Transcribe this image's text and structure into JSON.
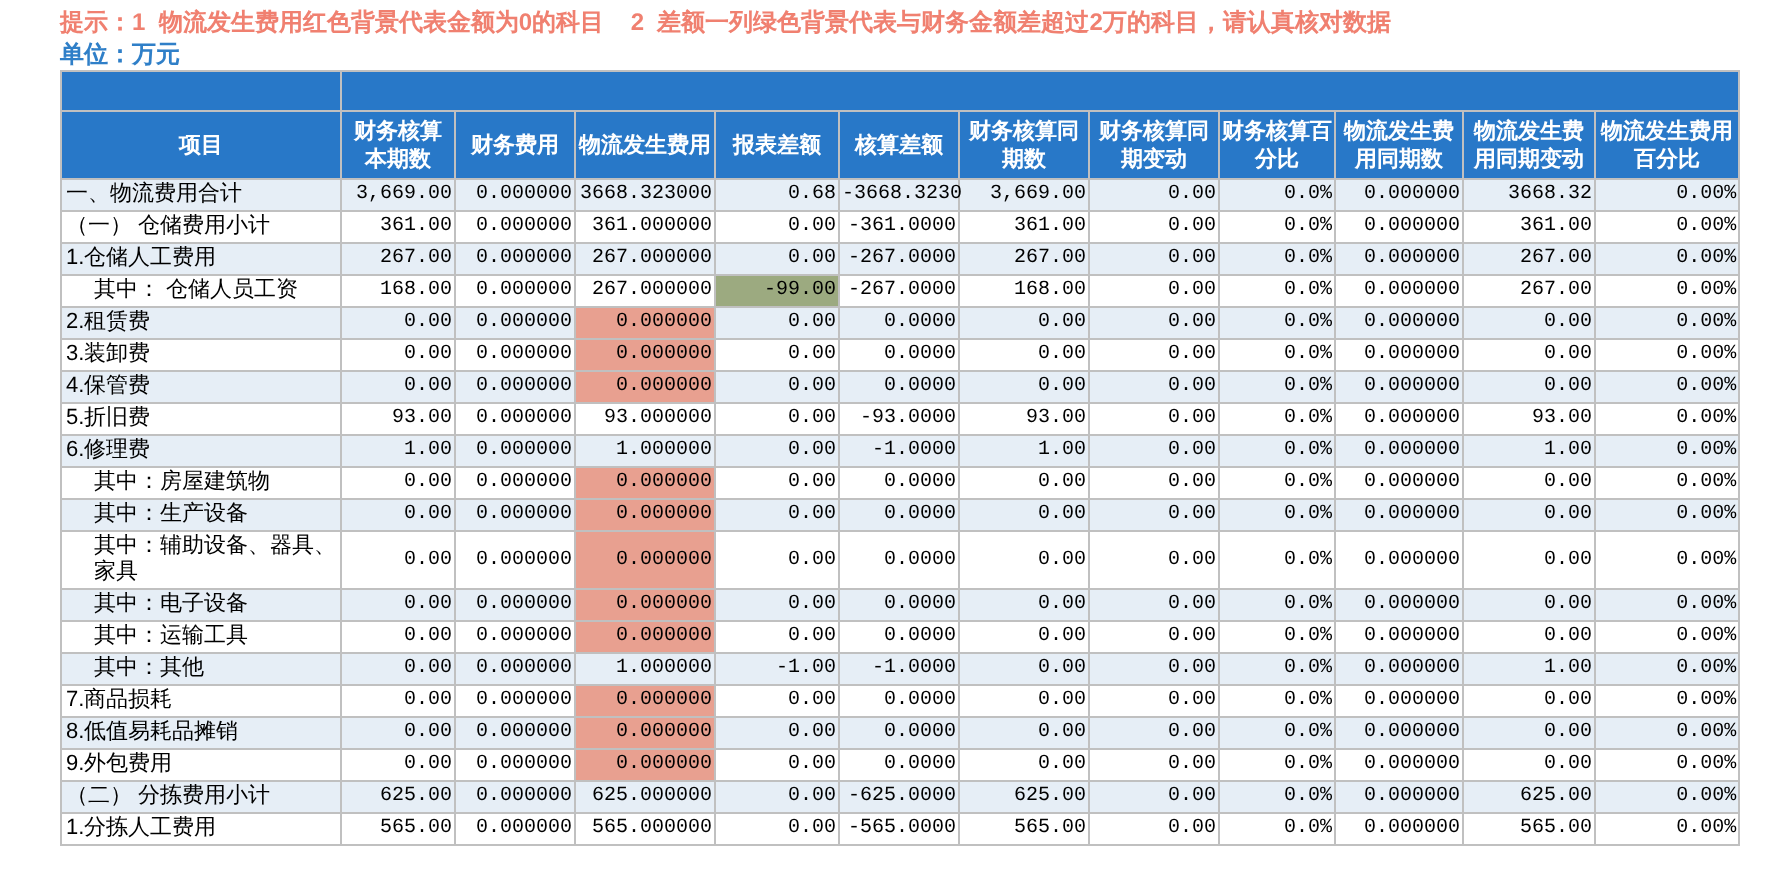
{
  "notice": "提示：1  物流发生费用红色背景代表金额为0的科目    2  差额一列绿色背景代表与财务金额差超过2万的科目，请认真核对数据",
  "unit": "单位：万元",
  "columns": [
    "项目",
    "财务核算本期数",
    "财务费用",
    "物流发生费用",
    "报表差额",
    "核算差额",
    "财务核算同期数",
    "财务核算同期变动",
    "财务核算百分比",
    "物流发生费用同期数",
    "物流发生费用同期变动",
    "物流发生费用百分比"
  ],
  "rows": [
    {
      "item": "一、物流费用合计",
      "kind": "main",
      "zero_flag": false,
      "diff_flag": false,
      "values": [
        "3,669.00",
        "0.000000",
        "3668.323000",
        "0.68",
        "-3668.3230",
        "3,669.00",
        "0.00",
        "0.0%",
        "0.000000",
        "3668.32",
        "0.00%"
      ]
    },
    {
      "item": "（一）  仓储费用小计",
      "kind": "main",
      "zero_flag": false,
      "diff_flag": false,
      "values": [
        "361.00",
        "0.000000",
        "361.000000",
        "0.00",
        "-361.0000",
        "361.00",
        "0.00",
        "0.0%",
        "0.000000",
        "361.00",
        "0.00%"
      ]
    },
    {
      "item": "1.仓储人工费用",
      "kind": "main",
      "zero_flag": false,
      "diff_flag": false,
      "values": [
        "267.00",
        "0.000000",
        "267.000000",
        "0.00",
        "-267.0000",
        "267.00",
        "0.00",
        "0.0%",
        "0.000000",
        "267.00",
        "0.00%"
      ]
    },
    {
      "item": "其中：  仓储人员工资",
      "kind": "sub",
      "zero_flag": false,
      "diff_flag": true,
      "values": [
        "168.00",
        "0.000000",
        "267.000000",
        "-99.00",
        "-267.0000",
        "168.00",
        "0.00",
        "0.0%",
        "0.000000",
        "267.00",
        "0.00%"
      ]
    },
    {
      "item": "2.租赁费",
      "kind": "main",
      "zero_flag": true,
      "diff_flag": false,
      "values": [
        "0.00",
        "0.000000",
        "0.000000",
        "0.00",
        "0.0000",
        "0.00",
        "0.00",
        "0.0%",
        "0.000000",
        "0.00",
        "0.00%"
      ]
    },
    {
      "item": "3.装卸费",
      "kind": "main",
      "zero_flag": true,
      "diff_flag": false,
      "values": [
        "0.00",
        "0.000000",
        "0.000000",
        "0.00",
        "0.0000",
        "0.00",
        "0.00",
        "0.0%",
        "0.000000",
        "0.00",
        "0.00%"
      ]
    },
    {
      "item": "4.保管费",
      "kind": "main",
      "zero_flag": true,
      "diff_flag": false,
      "values": [
        "0.00",
        "0.000000",
        "0.000000",
        "0.00",
        "0.0000",
        "0.00",
        "0.00",
        "0.0%",
        "0.000000",
        "0.00",
        "0.00%"
      ]
    },
    {
      "item": "5.折旧费",
      "kind": "main",
      "zero_flag": false,
      "diff_flag": false,
      "values": [
        "93.00",
        "0.000000",
        "93.000000",
        "0.00",
        "-93.0000",
        "93.00",
        "0.00",
        "0.0%",
        "0.000000",
        "93.00",
        "0.00%"
      ]
    },
    {
      "item": "6.修理费",
      "kind": "main",
      "zero_flag": false,
      "diff_flag": false,
      "values": [
        "1.00",
        "0.000000",
        "1.000000",
        "0.00",
        "-1.0000",
        "1.00",
        "0.00",
        "0.0%",
        "0.000000",
        "1.00",
        "0.00%"
      ]
    },
    {
      "item": "其中：房屋建筑物",
      "kind": "sub",
      "zero_flag": true,
      "diff_flag": false,
      "values": [
        "0.00",
        "0.000000",
        "0.000000",
        "0.00",
        "0.0000",
        "0.00",
        "0.00",
        "0.0%",
        "0.000000",
        "0.00",
        "0.00%"
      ]
    },
    {
      "item": "其中：生产设备",
      "kind": "sub",
      "zero_flag": true,
      "diff_flag": false,
      "values": [
        "0.00",
        "0.000000",
        "0.000000",
        "0.00",
        "0.0000",
        "0.00",
        "0.00",
        "0.0%",
        "0.000000",
        "0.00",
        "0.00%"
      ]
    },
    {
      "item": "其中：辅助设备、器具、家具",
      "kind": "sub",
      "zero_flag": true,
      "diff_flag": false,
      "values": [
        "0.00",
        "0.000000",
        "0.000000",
        "0.00",
        "0.0000",
        "0.00",
        "0.00",
        "0.0%",
        "0.000000",
        "0.00",
        "0.00%"
      ]
    },
    {
      "item": "其中：电子设备",
      "kind": "sub",
      "zero_flag": true,
      "diff_flag": false,
      "values": [
        "0.00",
        "0.000000",
        "0.000000",
        "0.00",
        "0.0000",
        "0.00",
        "0.00",
        "0.0%",
        "0.000000",
        "0.00",
        "0.00%"
      ]
    },
    {
      "item": "其中：运输工具",
      "kind": "sub",
      "zero_flag": true,
      "diff_flag": false,
      "values": [
        "0.00",
        "0.000000",
        "0.000000",
        "0.00",
        "0.0000",
        "0.00",
        "0.00",
        "0.0%",
        "0.000000",
        "0.00",
        "0.00%"
      ]
    },
    {
      "item": "其中：其他",
      "kind": "sub",
      "zero_flag": false,
      "diff_flag": false,
      "values": [
        "0.00",
        "0.000000",
        "1.000000",
        "-1.00",
        "-1.0000",
        "0.00",
        "0.00",
        "0.0%",
        "0.000000",
        "1.00",
        "0.00%"
      ]
    },
    {
      "item": "7.商品损耗",
      "kind": "main",
      "zero_flag": true,
      "diff_flag": false,
      "values": [
        "0.00",
        "0.000000",
        "0.000000",
        "0.00",
        "0.0000",
        "0.00",
        "0.00",
        "0.0%",
        "0.000000",
        "0.00",
        "0.00%"
      ]
    },
    {
      "item": "8.低值易耗品摊销",
      "kind": "main",
      "zero_flag": true,
      "diff_flag": false,
      "values": [
        "0.00",
        "0.000000",
        "0.000000",
        "0.00",
        "0.0000",
        "0.00",
        "0.00",
        "0.0%",
        "0.000000",
        "0.00",
        "0.00%"
      ]
    },
    {
      "item": "9.外包费用",
      "kind": "main",
      "zero_flag": true,
      "diff_flag": false,
      "values": [
        "0.00",
        "0.000000",
        "0.000000",
        "0.00",
        "0.0000",
        "0.00",
        "0.00",
        "0.0%",
        "0.000000",
        "0.00",
        "0.00%"
      ]
    },
    {
      "item": "（二）  分拣费用小计",
      "kind": "main",
      "zero_flag": false,
      "diff_flag": false,
      "values": [
        "625.00",
        "0.000000",
        "625.000000",
        "0.00",
        "-625.0000",
        "625.00",
        "0.00",
        "0.0%",
        "0.000000",
        "625.00",
        "0.00%"
      ]
    },
    {
      "item": "1.分拣人工费用",
      "kind": "main",
      "zero_flag": false,
      "diff_flag": false,
      "values": [
        "565.00",
        "0.000000",
        "565.000000",
        "0.00",
        "-565.0000",
        "565.00",
        "0.00",
        "0.0%",
        "0.000000",
        "565.00",
        "0.00%"
      ]
    }
  ]
}
